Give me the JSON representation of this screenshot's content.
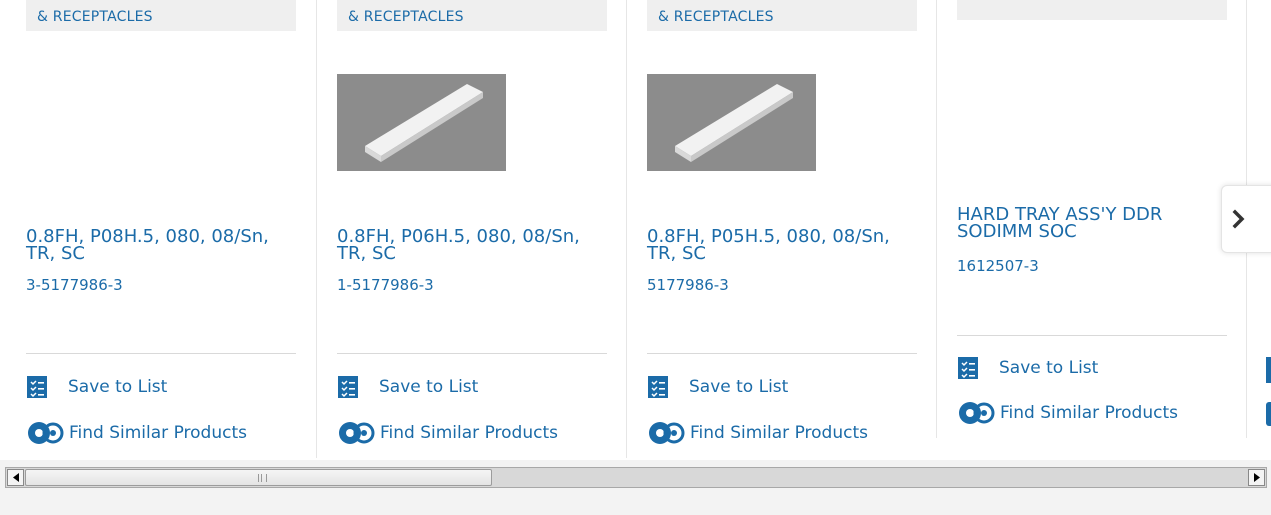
{
  "products": [
    {
      "category": "& RECEPTACLES",
      "has_image": false,
      "title": "0.8FH, P08H.5, 080, 08/Sn, TR, SC",
      "part_number": "3-5177986-3",
      "save_label": "Save to List",
      "similar_label": "Find Similar Products"
    },
    {
      "category": "& RECEPTACLES",
      "has_image": true,
      "title": "0.8FH, P06H.5, 080, 08/Sn, TR, SC",
      "part_number": "1-5177986-3",
      "save_label": "Save to List",
      "similar_label": "Find Similar Products"
    },
    {
      "category": "& RECEPTACLES",
      "has_image": true,
      "title": "0.8FH, P05H.5, 080, 08/Sn, TR, SC",
      "part_number": "5177986-3",
      "save_label": "Save to List",
      "similar_label": "Find Similar Products"
    },
    {
      "category": "",
      "has_image": false,
      "title": "HARD TRAY ASS'Y DDR SODIMM SOC",
      "part_number": "1612507-3",
      "save_label": "Save to List",
      "similar_label": "Find Similar Products"
    }
  ],
  "colors": {
    "link": "#1b6ba8",
    "icon": "#1b6ba8",
    "divider": "#e6e6e6",
    "category_bg": "#efefef"
  },
  "icons": {
    "save": "checklist-icon",
    "similar": "gear-icon",
    "next": "chevron-right-icon"
  }
}
